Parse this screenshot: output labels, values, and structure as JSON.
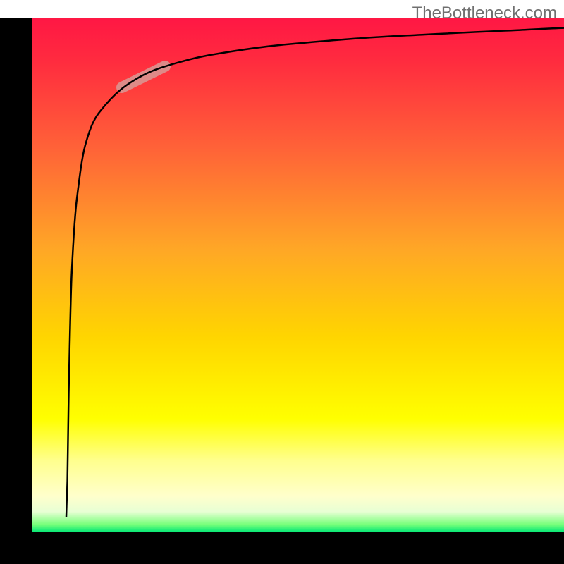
{
  "watermark": "TheBottleneck.com",
  "chart_data": {
    "type": "line",
    "title": "",
    "xlabel": "",
    "ylabel": "",
    "xlim": [
      0,
      100
    ],
    "ylim": [
      0,
      100
    ],
    "background_gradient": {
      "stops": [
        {
          "offset": 0.0,
          "color": "#ff1744"
        },
        {
          "offset": 0.08,
          "color": "#ff2a3f"
        },
        {
          "offset": 0.25,
          "color": "#ff6138"
        },
        {
          "offset": 0.45,
          "color": "#ffa726"
        },
        {
          "offset": 0.62,
          "color": "#ffd500"
        },
        {
          "offset": 0.78,
          "color": "#ffff00"
        },
        {
          "offset": 0.86,
          "color": "#ffff8d"
        },
        {
          "offset": 0.93,
          "color": "#ffffcc"
        },
        {
          "offset": 0.96,
          "color": "#e8ffd4"
        },
        {
          "offset": 0.985,
          "color": "#76ff7a"
        },
        {
          "offset": 1.0,
          "color": "#00e676"
        }
      ]
    },
    "frame": {
      "left_margin": 45,
      "right_margin": 0,
      "top_margin": 25,
      "bottom_margin": 45,
      "stroke": "#000000"
    },
    "curve": {
      "comment": "Logarithmic-like curve starting near bottom-left, rising steeply, asymptoting near top",
      "points": [
        {
          "x": 6.5,
          "y": 3
        },
        {
          "x": 6.7,
          "y": 10
        },
        {
          "x": 7.0,
          "y": 30
        },
        {
          "x": 7.5,
          "y": 50
        },
        {
          "x": 8.5,
          "y": 65
        },
        {
          "x": 10,
          "y": 75
        },
        {
          "x": 13,
          "y": 82
        },
        {
          "x": 18,
          "y": 87
        },
        {
          "x": 25,
          "y": 90.5
        },
        {
          "x": 35,
          "y": 93
        },
        {
          "x": 50,
          "y": 95
        },
        {
          "x": 70,
          "y": 96.5
        },
        {
          "x": 90,
          "y": 97.5
        },
        {
          "x": 100,
          "y": 98
        }
      ],
      "stroke": "#000000",
      "stroke_width": 2.5
    },
    "highlight_segment": {
      "comment": "Pink/salmon highlighted pill segment on curve",
      "x_start": 17,
      "x_end": 25,
      "color": "#d89a95",
      "opacity": 0.85,
      "width": 16
    }
  }
}
